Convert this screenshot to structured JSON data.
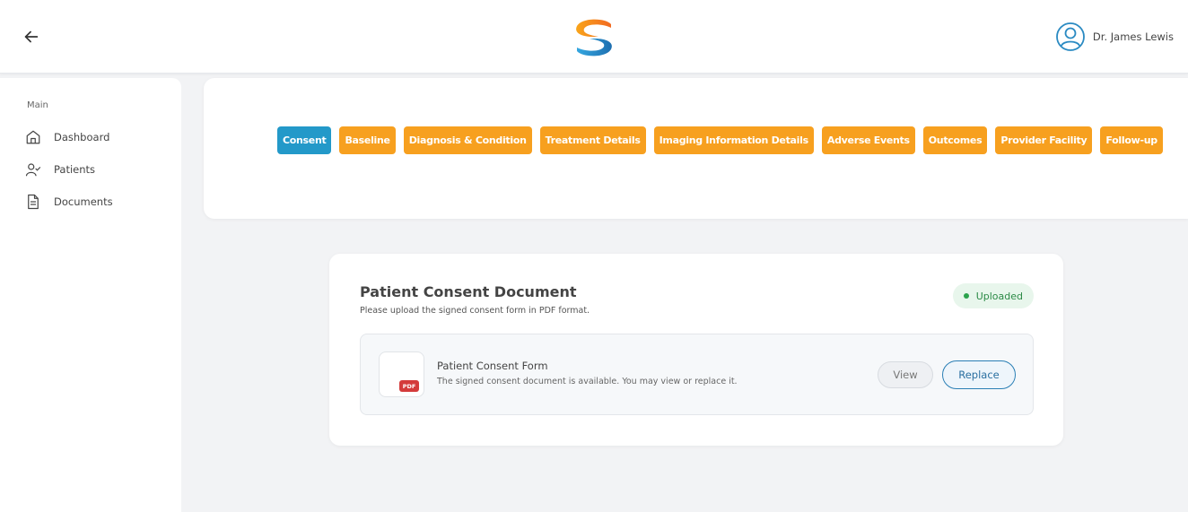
{
  "header": {
    "user_name": "Dr. James Lewis",
    "icons": {
      "back": "arrow-left-icon",
      "logo": "brand-logo",
      "user": "user-circle-icon"
    }
  },
  "sidebar": {
    "section_label": "Main",
    "items": [
      {
        "label": "Dashboard",
        "icon": "home-icon"
      },
      {
        "label": "Patients",
        "icon": "user-check-icon"
      },
      {
        "label": "Documents",
        "icon": "document-icon"
      }
    ]
  },
  "tabs": [
    {
      "label": "Consent",
      "active": true
    },
    {
      "label": "Baseline",
      "active": false
    },
    {
      "label": "Diagnosis & Condition",
      "active": false
    },
    {
      "label": "Treatment Details",
      "active": false
    },
    {
      "label": "Imaging Information Details",
      "active": false
    },
    {
      "label": "Adverse Events",
      "active": false
    },
    {
      "label": "Outcomes",
      "active": false
    },
    {
      "label": "Provider Facility",
      "active": false
    },
    {
      "label": "Follow-up",
      "active": false
    }
  ],
  "consent": {
    "title": "Patient Consent Document",
    "subtitle": "Please upload the signed consent form in PDF format.",
    "status": "Uploaded",
    "file": {
      "badge": "PDF",
      "name": "Patient Consent Form",
      "description": "The signed consent document is available. You may view or replace it."
    },
    "view_label": "View",
    "replace_label": "Replace"
  },
  "colors": {
    "tab_active": "#2399c9",
    "tab_inactive": "#f7a01f",
    "status_green": "#2b8a46",
    "replace_blue": "#2a7fb5"
  }
}
